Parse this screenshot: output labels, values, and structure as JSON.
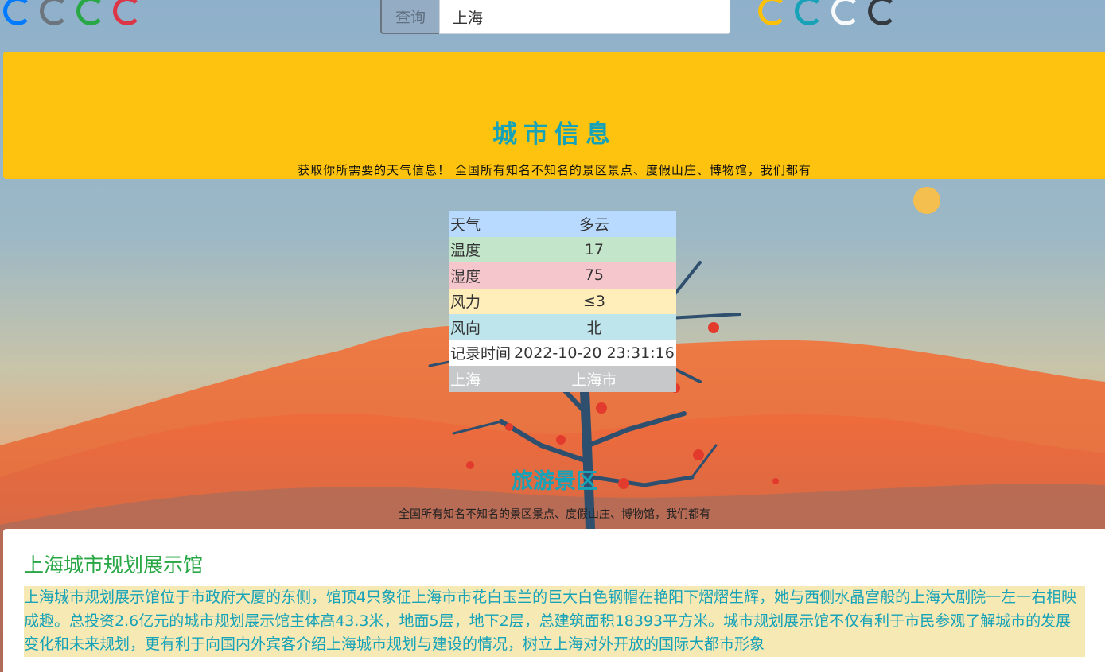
{
  "spinners": {
    "left": [
      "#007bff",
      "#6c757d",
      "#28a745",
      "#dc3545"
    ],
    "right": [
      "#ffc107",
      "#17a2b8",
      "#f8f9fa",
      "#343a40"
    ]
  },
  "search": {
    "button_label": "查询",
    "value": "上海"
  },
  "banner": {
    "title": "城市信息",
    "subtitle": "获取你所需要的天气信息！ 全国所有知名不知名的景区景点、度假山庄、博物馆，我们都有"
  },
  "weather": {
    "rows": [
      {
        "label": "天气",
        "value": "多云",
        "style": "primary"
      },
      {
        "label": "温度",
        "value": "17",
        "style": "success"
      },
      {
        "label": "湿度",
        "value": "75",
        "style": "danger"
      },
      {
        "label": "风力",
        "value": "≤3",
        "style": "warning"
      },
      {
        "label": "风向",
        "value": "北",
        "style": "info"
      },
      {
        "label": "记录时间",
        "value": "2022-10-20 23:31:16",
        "style": "light"
      },
      {
        "label": "上海",
        "value": "上海市",
        "style": "dark"
      }
    ]
  },
  "tourism": {
    "title": "旅游景区",
    "subtitle": "全国所有知名不知名的景区景点、度假山庄、博物馆，我们都有"
  },
  "attraction": {
    "name": "上海城市规划展示馆",
    "description": "上海城市规划展示馆位于市政府大厦的东侧，馆顶4只象征上海市市花白玉兰的巨大白色钢帽在艳阳下熠熠生辉，她与西侧水晶宫般的上海大剧院一左一右相映成趣。总投资2.6亿元的城市规划展示馆主体高43.3米，地面5层，地下2层，总建筑面积18393平方米。城市规划展示馆不仅有利于市民参观了解城市的发展变化和未来规划，更有利于向国内外宾客介绍上海城市规划与建设的情况，树立上海对外开放的国际大都市形象"
  }
}
